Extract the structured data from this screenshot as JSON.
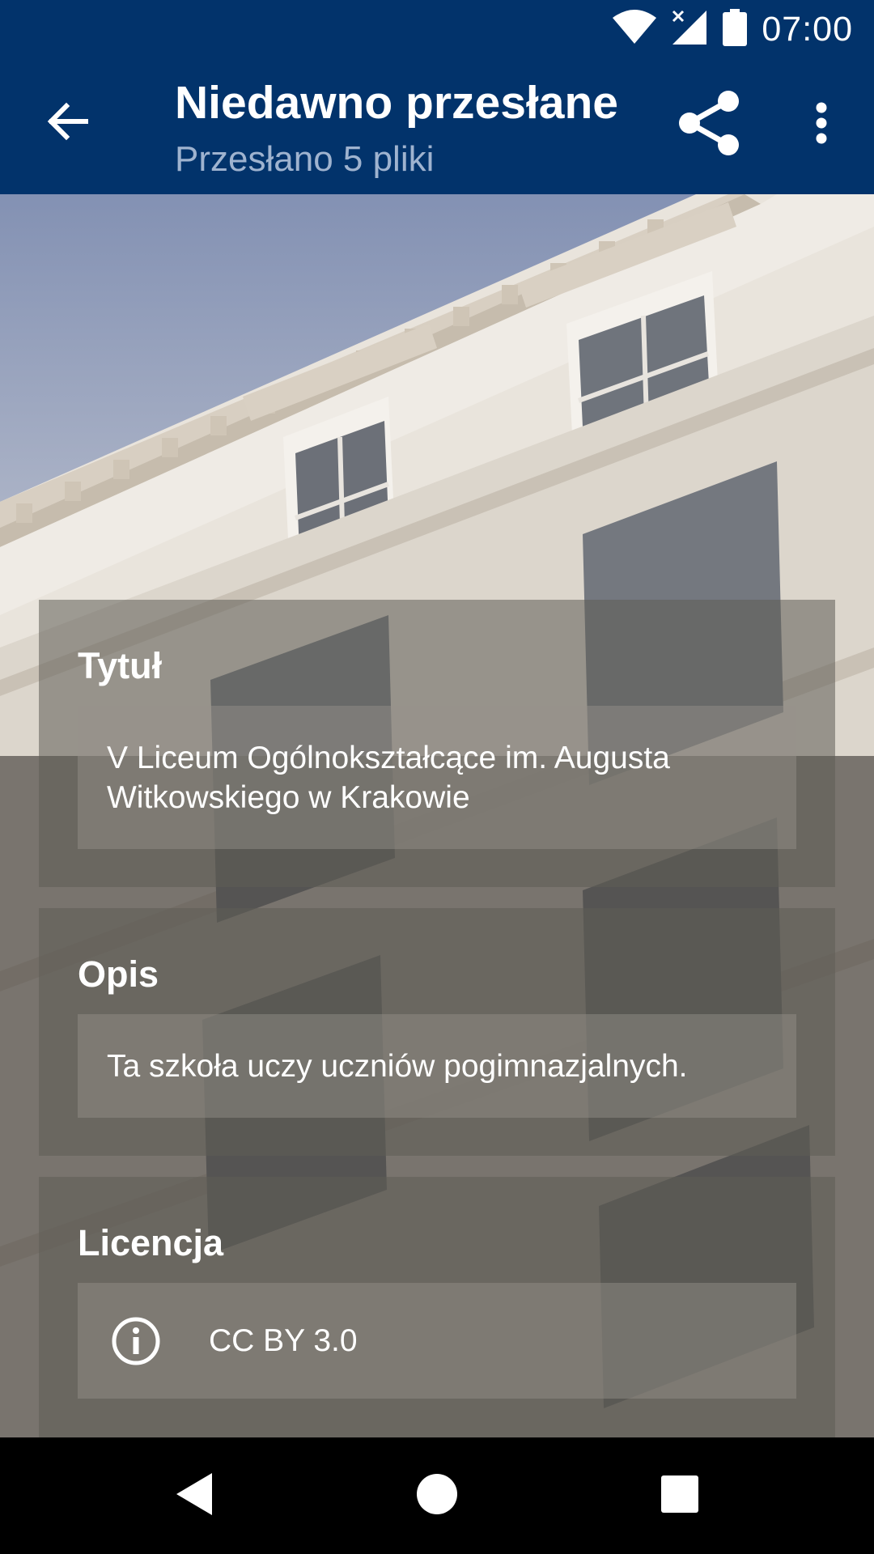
{
  "status_bar": {
    "time": "07:00",
    "icons": [
      "wifi-icon",
      "signal-no-service-icon",
      "battery-icon"
    ]
  },
  "app_bar": {
    "title": "Niedawno przesłane",
    "subtitle": "Przesłano 5 pliki",
    "icons": [
      "arrow-back-icon",
      "share-icon",
      "more-vert-icon"
    ]
  },
  "details": {
    "title_section": {
      "label": "Tytuł",
      "value": "V Liceum Ogólnokształcące im. Augusta Witkowskiego w Krakowie"
    },
    "description_section": {
      "label": "Opis",
      "value": "Ta szkoła uczy uczniów pogimnazjalnych."
    },
    "license_section": {
      "label": "Licencja",
      "value": "CC BY 3.0",
      "icon": "info-icon"
    }
  },
  "nav_bar": {
    "icons": [
      "nav-back-icon",
      "nav-home-icon",
      "nav-recents-icon"
    ]
  },
  "colors": {
    "primary": "#02336b",
    "subtitle": "#9fb3cf",
    "overlay": "#46423c"
  }
}
